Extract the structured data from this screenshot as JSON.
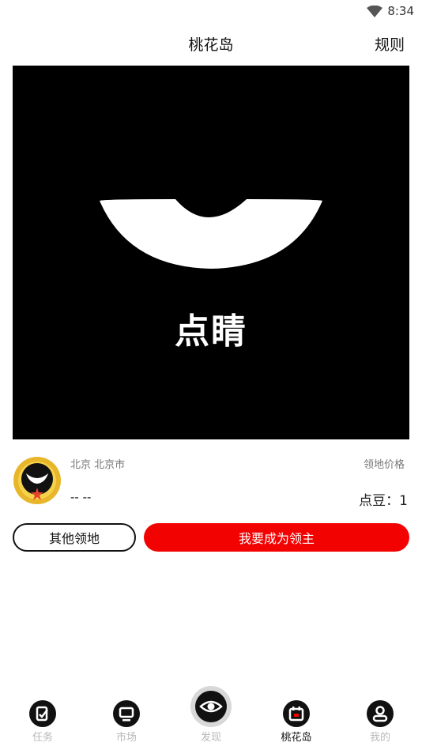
{
  "status": {
    "time": "8:34"
  },
  "header": {
    "title": "桃花岛",
    "rules_label": "规则"
  },
  "banner": {
    "brand_text": "点睛",
    "bg_color": "#000000"
  },
  "info": {
    "location": "北京 北京市",
    "owner_name": "-- --",
    "price_label": "领地价格",
    "price_value": "点豆：1"
  },
  "actions": {
    "other_label": "其他领地",
    "lord_label": "我要成为领主",
    "accent_color": "#f30202"
  },
  "tabbar": {
    "items": [
      {
        "label": "任务",
        "icon": "task-icon",
        "active": false
      },
      {
        "label": "市场",
        "icon": "monitor-icon",
        "active": false
      },
      {
        "label": "发现",
        "icon": "eye-icon",
        "active": false
      },
      {
        "label": "桃花岛",
        "icon": "calendar-icon",
        "active": true
      },
      {
        "label": "我的",
        "icon": "user-icon",
        "active": false
      }
    ]
  }
}
